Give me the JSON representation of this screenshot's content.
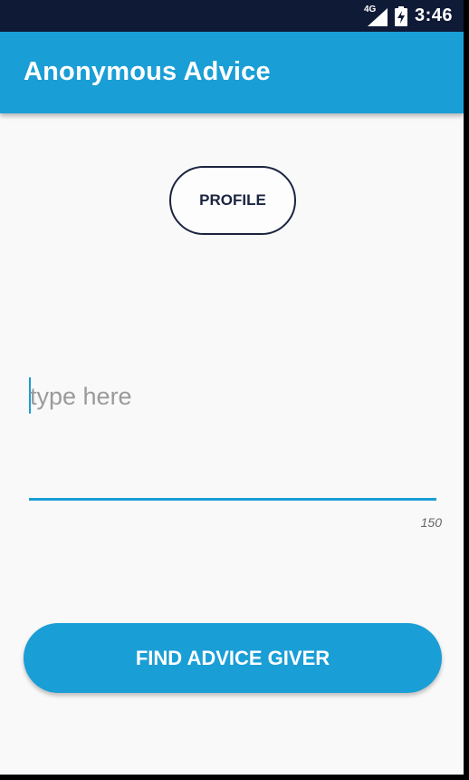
{
  "status_bar": {
    "network_label": "4G",
    "time": "3:46",
    "icons": [
      "signal-icon",
      "battery-charging-icon"
    ]
  },
  "app_bar": {
    "title": "Anonymous Advice"
  },
  "profile_button": {
    "label": "PROFILE"
  },
  "message_input": {
    "placeholder": "type here",
    "char_counter": "150"
  },
  "find_button": {
    "label": "FIND ADVICE GIVER"
  },
  "colors": {
    "accent": "#1a9ed6",
    "status_bar": "#0f1a36",
    "outline": "#1b2440",
    "background": "#f9f9f9"
  }
}
